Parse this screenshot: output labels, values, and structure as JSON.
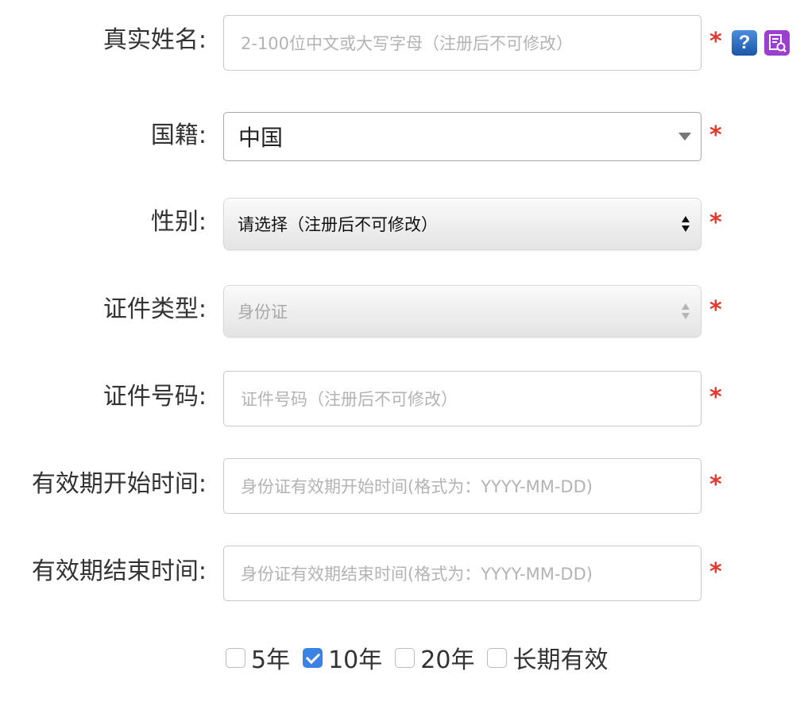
{
  "form": {
    "real_name": {
      "label": "真实姓名:",
      "placeholder": "2-100位中文或大写字母（注册后不可修改）",
      "required_mark": "*"
    },
    "nationality": {
      "label": "国籍:",
      "value": "中国",
      "required_mark": "*"
    },
    "gender": {
      "label": "性别:",
      "value": "请选择（注册后不可修改）",
      "required_mark": "*"
    },
    "id_type": {
      "label": "证件类型:",
      "value": "身份证",
      "disabled": true,
      "required_mark": "*"
    },
    "id_number": {
      "label": "证件号码:",
      "placeholder": "证件号码（注册后不可修改）",
      "required_mark": "*"
    },
    "valid_start": {
      "label": "有效期开始时间:",
      "placeholder": "身份证有效期开始时间(格式为：YYYY-MM-DD)",
      "required_mark": "*"
    },
    "valid_end": {
      "label": "有效期结束时间:",
      "placeholder": "身份证有效期结束时间(格式为：YYYY-MM-DD)",
      "required_mark": "*"
    }
  },
  "icons": {
    "help": "question-mark-icon",
    "help_glyph": "?",
    "lookup": "book-search-icon"
  },
  "validity_options": [
    {
      "label": "5年",
      "checked": false
    },
    {
      "label": "10年",
      "checked": true
    },
    {
      "label": "20年",
      "checked": false
    },
    {
      "label": "长期有效",
      "checked": false
    }
  ],
  "colors": {
    "required": "#e23a2e",
    "checkbox_checked": "#3b82e6",
    "help_icon": "#1c56a8",
    "lookup_icon": "#9b3fd0"
  }
}
